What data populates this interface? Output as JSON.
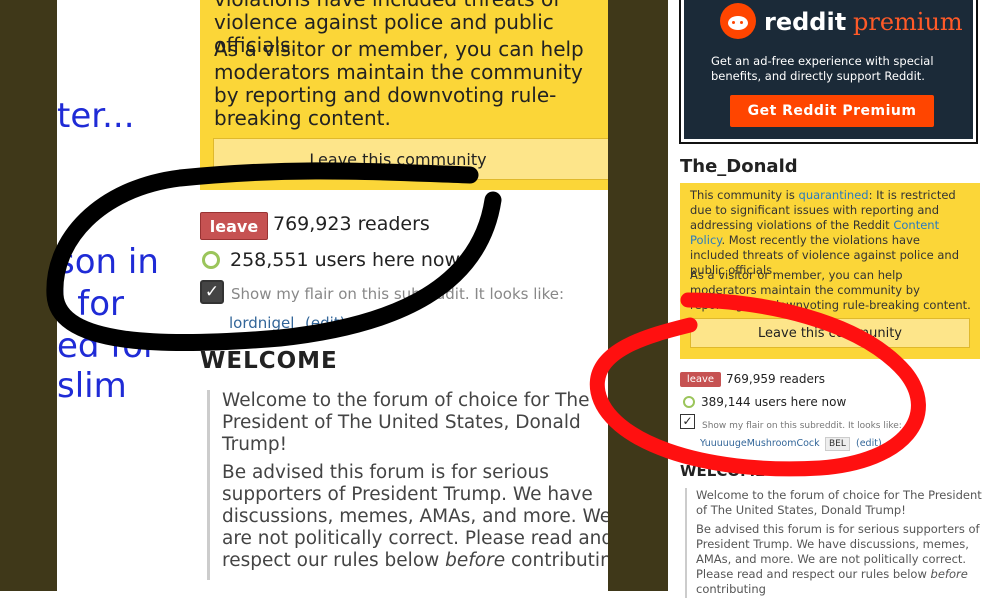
{
  "left_panel": {
    "cut_text": [
      "ter...",
      "son in",
      "l for",
      "ed for",
      "slim"
    ],
    "quarantine_text_1": "violations have included threats of violence against police and public officials.",
    "quarantine_text_2": "As a visitor or member, you can help moderators maintain the community by reporting and downvoting rule-breaking content.",
    "leave_button": "Leave this community",
    "leave_badge": "leave",
    "readers": "769,923 readers",
    "online": "258,551 users here now",
    "flair_text": "Show my flair on this subreddit. It looks like:",
    "flair_user": "lordnigel",
    "flair_edit": "(edit)",
    "welcome": "WELCOME",
    "welcome_p1": "Welcome to the forum of choice for The President of The United States, Donald Trump!",
    "welcome_p2_a": "Be advised this forum is for serious supporters of President Trump. We have discussions, memes, AMAs, and more. We are not politically correct. Please read and respect our rules below ",
    "welcome_p2_em": "before",
    "welcome_p2_b": " contributing"
  },
  "right_panel": {
    "premium": {
      "brand_1": "reddit",
      "brand_2": "premium",
      "description": "Get an ad-free experience with special benefits, and directly support Reddit.",
      "button": "Get Reddit Premium"
    },
    "subreddit_title": "The_Donald",
    "quarantine": {
      "prefix": "This community is ",
      "link_1": "quarantined",
      "middle": ": It is restricted due to significant issues with reporting and addressing violations of the Reddit ",
      "link_2": "Content Policy",
      "suffix": ". Most recently the violations have included threats of violence against police and public officials.",
      "para_2": "As a visitor or member, you can help moderators maintain the community by reporting and downvoting rule-breaking content.",
      "leave_button": "Leave this community"
    },
    "leave_badge": "leave",
    "readers": "769,959 readers",
    "online": "389,144 users here now",
    "flair_text": "Show my flair on this subreddit. It looks like:",
    "flair_user": "YuuuuugeMushroomCock",
    "flair_tag": "BEL",
    "flair_edit": "(edit)",
    "welcome": "WELCOME",
    "welcome_p1": "Welcome to the forum of choice for The President of The United States, Donald Trump!",
    "welcome_p2_a": "Be advised this forum is for serious supporters of President Trump. We have discussions, memes, AMAs, and more. We are not politically correct. Please read and respect our rules below ",
    "welcome_p2_em": "before",
    "welcome_p2_b": " contributing"
  },
  "colors": {
    "quarantine_yellow": "#fbd638",
    "leave_red": "#c65252",
    "premium_orange": "#ff4500",
    "black_annotation": "#000000",
    "red_annotation": "#ff1010"
  },
  "icons": [
    "reddit-snoo-icon",
    "online-dot-icon",
    "checkbox-checked-icon"
  ]
}
